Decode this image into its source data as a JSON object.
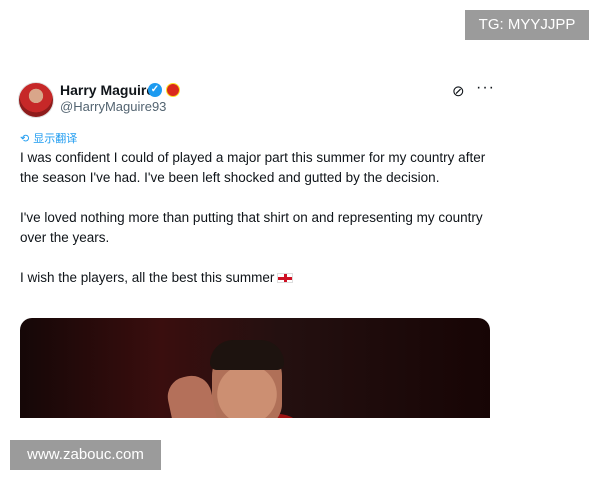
{
  "tweet": {
    "author_name": "Harry Maguire",
    "author_handle": "@HarryMaguire93",
    "translate_label": "显示翻译",
    "paragraphs": [
      "I was confident I could of played a major part this summer for my country after the season I've had. I've been left shocked and gutted by the decision.",
      "I've loved nothing more than putting that shirt on and representing my country over the years.",
      "I wish the players, all the best this summer"
    ],
    "icons": {
      "verified": "verified-badge-icon",
      "affiliation": "club-badge-icon",
      "grok": "grok-icon",
      "more": "more-icon",
      "translate": "translate-icon",
      "flag": "england-flag-icon"
    },
    "colors": {
      "accent": "#1d9bf0",
      "text": "#0f1419",
      "secondary": "#536471"
    }
  },
  "watermarks": {
    "top_right": "TG: MYYJJPP",
    "bottom_left": "www.zabouc.com"
  }
}
